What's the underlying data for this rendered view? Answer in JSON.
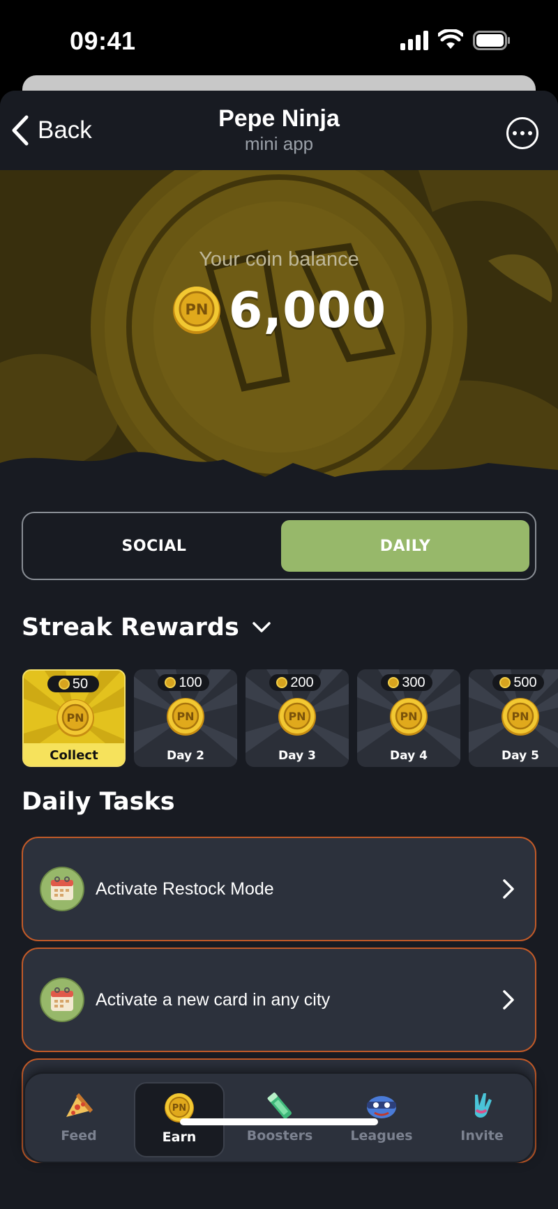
{
  "status_bar": {
    "time": "09:41"
  },
  "header": {
    "back_label": "Back",
    "title": "Pepe Ninja",
    "subtitle": "mini app"
  },
  "hero": {
    "balance_label": "Your coin balance",
    "balance_value": "6,000"
  },
  "tabs_toggle": {
    "social": "SOCIAL",
    "daily": "DAILY",
    "selected": "DAILY"
  },
  "streak": {
    "title": "Streak Rewards",
    "cards": [
      {
        "reward": "50",
        "label": "Collect",
        "active": true
      },
      {
        "reward": "100",
        "label": "Day 2",
        "active": false
      },
      {
        "reward": "200",
        "label": "Day 3",
        "active": false
      },
      {
        "reward": "300",
        "label": "Day 4",
        "active": false
      },
      {
        "reward": "500",
        "label": "Day 5",
        "active": false
      }
    ]
  },
  "daily_tasks": {
    "title": "Daily Tasks",
    "items": [
      {
        "label": "Activate Restock Mode"
      },
      {
        "label": "Activate a new card in any city"
      }
    ]
  },
  "bottom_nav": {
    "items": [
      {
        "label": "Feed",
        "icon": "pizza-icon"
      },
      {
        "label": "Earn",
        "icon": "coin-icon",
        "active": true
      },
      {
        "label": "Boosters",
        "icon": "booster-icon"
      },
      {
        "label": "Leagues",
        "icon": "ninja-mask-icon"
      },
      {
        "label": "Invite",
        "icon": "hand-icon"
      }
    ]
  },
  "colors": {
    "accent_green": "#97b86a",
    "coin_gold": "#e3b21e",
    "task_border": "#c25a28",
    "background": "#181b22"
  }
}
